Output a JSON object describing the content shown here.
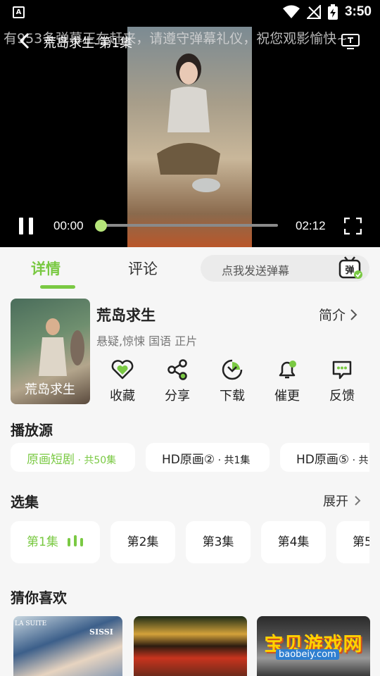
{
  "status_bar": {
    "notification_icon": "A",
    "time": "3:50"
  },
  "player": {
    "danmaku_text": "有953条弹幕正在赶来，请遵守弹幕礼仪，祝您观影愉快~",
    "title": "荒岛求生-第1集",
    "current_time": "00:00",
    "duration": "02:12",
    "progress": 0.0
  },
  "tabs": {
    "details": "详情",
    "comments": "评论"
  },
  "danmu_input": {
    "placeholder": "点我发送弹幕",
    "send_icon_label": "弹"
  },
  "show": {
    "title": "荒岛求生",
    "intro_label": "简介",
    "tags": "悬疑,惊悚 国语 正片",
    "poster_text": "荒岛求生"
  },
  "actions": [
    {
      "label": "收藏",
      "icon": "heart-icon"
    },
    {
      "label": "分享",
      "icon": "share-icon"
    },
    {
      "label": "下载",
      "icon": "download-icon"
    },
    {
      "label": "催更",
      "icon": "bell-icon"
    },
    {
      "label": "反馈",
      "icon": "feedback-icon"
    }
  ],
  "sources": {
    "title": "播放源",
    "items": [
      {
        "name": "原画短剧",
        "count": " · 共50集"
      },
      {
        "name": "HD原画②",
        "count": " · 共1集"
      },
      {
        "name": "HD原画⑤",
        "count": " · 共"
      }
    ]
  },
  "episodes": {
    "title": "选集",
    "expand_label": "展开",
    "items": [
      "第1集",
      "第2集",
      "第3集",
      "第4集",
      "第5"
    ]
  },
  "recommendations": {
    "title": "猜你喜欢",
    "items": [
      {
        "text_line1": "LA SUITE",
        "text_line2": "SISSI"
      },
      {
        "text_line1": ""
      },
      {
        "watermark": "宝贝游戏网",
        "watermark_url": "baobeiy.com"
      }
    ]
  },
  "colors": {
    "accent": "#7ac943",
    "background": "#f6f6f6"
  }
}
